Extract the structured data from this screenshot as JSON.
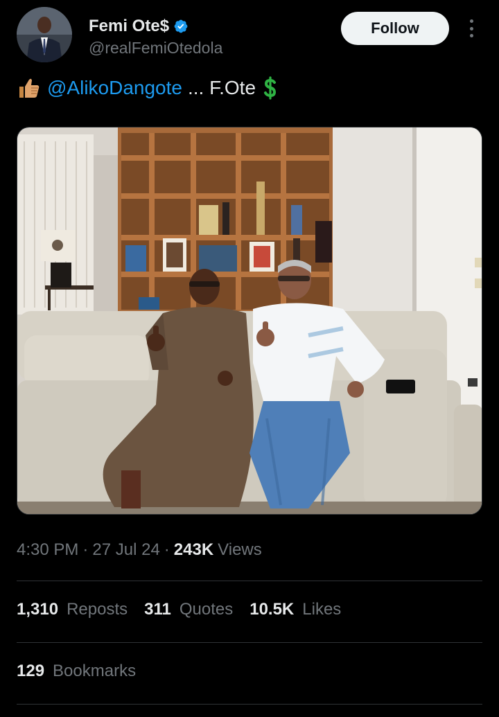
{
  "author": {
    "display_name": "Femi Ote$",
    "handle": "@realFemiOtedola",
    "verified": true,
    "avatar_icon": "profile-photo"
  },
  "follow_button": {
    "label": "Follow"
  },
  "more_menu": {
    "icon": "more-vertical-icon"
  },
  "tweet": {
    "emoji_prefix": "thumbs-up",
    "mention": "@AlikoDangote",
    "rest_text": "... F.Ote",
    "emoji_suffix": "heavy-dollar-sign"
  },
  "media": {
    "type": "photo",
    "description_icon": "two-men-on-sofa-photo"
  },
  "meta": {
    "time": "4:30 PM",
    "separator1": "·",
    "date": "27 Jul 24",
    "separator2": "·",
    "views_count": "243K",
    "views_label": "Views"
  },
  "stats": {
    "reposts": {
      "count": "1,310",
      "label": "Reposts"
    },
    "quotes": {
      "count": "311",
      "label": "Quotes"
    },
    "likes": {
      "count": "10.5K",
      "label": "Likes"
    },
    "bookmarks": {
      "count": "129",
      "label": "Bookmarks"
    }
  },
  "colors": {
    "background": "#000000",
    "text_primary": "#e7e9ea",
    "text_secondary": "#71767b",
    "link": "#1d9bf0",
    "verified": "#1d9bf0",
    "divider": "#2f3336",
    "follow_bg": "#eff3f4"
  }
}
